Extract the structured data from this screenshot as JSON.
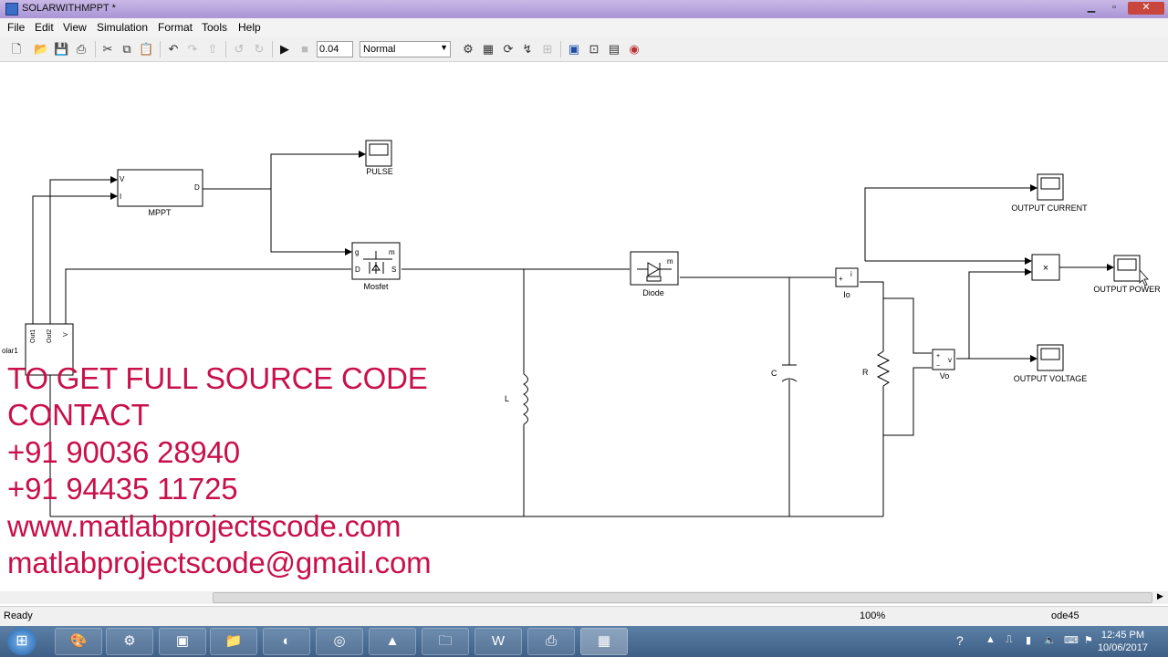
{
  "window": {
    "title": "SOLARWITHMPPT *"
  },
  "menu": [
    "File",
    "Edit",
    "View",
    "Simulation",
    "Format",
    "Tools",
    "Help"
  ],
  "toolbar": {
    "stop_time": "0.04",
    "sim_mode": "Normal"
  },
  "blocks": {
    "pulse": "PULSE",
    "mppt": "MPPT",
    "mppt_in_v": "V",
    "mppt_in_i": "I",
    "mppt_out_d": "D",
    "mosfet": "Mosfet",
    "mosfet_g": "g",
    "mosfet_m": "m",
    "mosfet_d": "D",
    "mosfet_s": "S",
    "diode": "Diode",
    "diode_m": "m",
    "output_current": "OUTPUT CURRENT",
    "output_power": "OUTPUT POWER",
    "output_voltage": "OUTPUT VOLTAGE",
    "product": "×",
    "io": "Io",
    "io_i": "i",
    "vo": "Vo",
    "vo_v": "v",
    "capacitor": "C",
    "resistor": "R",
    "inductor": "L",
    "solar": "olar1",
    "solar_out1": "Out1",
    "solar_out2": "Out2",
    "solar_v": "V"
  },
  "overlay": {
    "line1": "TO GET FULL SOURCE CODE",
    "line2": "CONTACT",
    "line3": "+91 90036 28940",
    "line4": "+91 94435 11725",
    "line5": "www.matlabprojectscode.com",
    "line6": "matlabprojectscode@gmail.com"
  },
  "status": {
    "state": "Ready",
    "zoom": "100%",
    "solver": "ode45"
  },
  "clock": {
    "time": "12:45 PM",
    "date": "10/06/2017"
  },
  "colors": {
    "overlay_text": "#c8104a",
    "taskbar": "#3e5f86"
  }
}
